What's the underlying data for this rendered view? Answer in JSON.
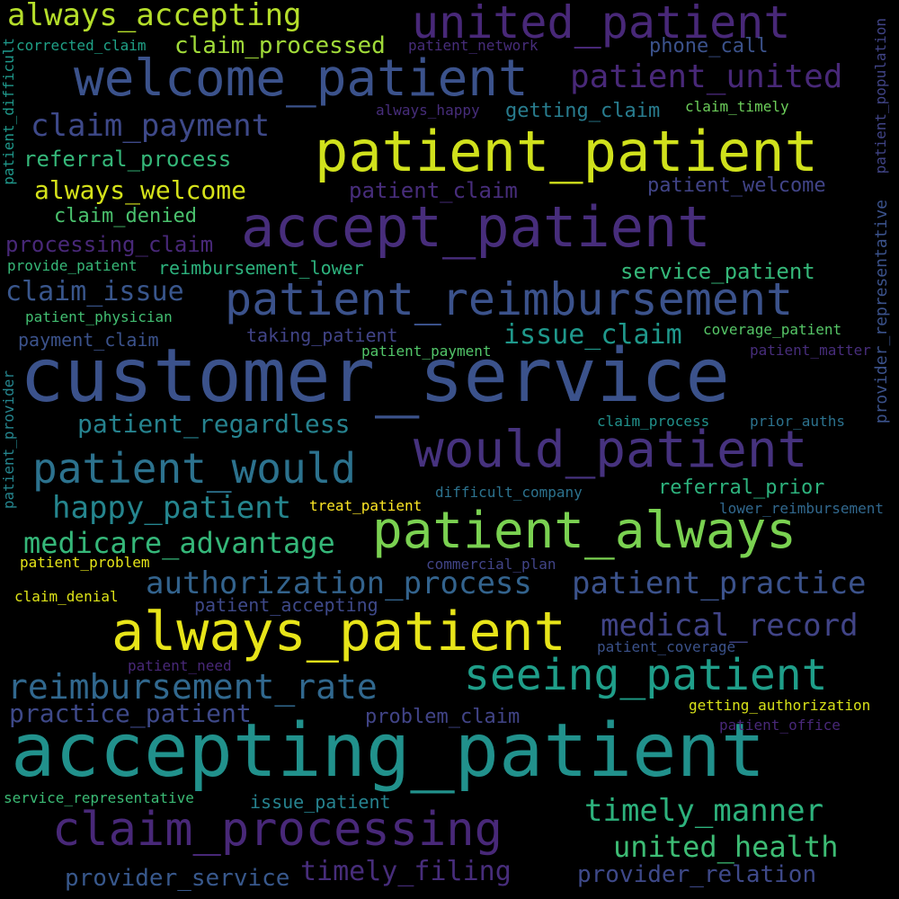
{
  "words": [
    {
      "key": "customer_service",
      "text": "customer_service",
      "color": "#3b528b"
    },
    {
      "key": "accepting_patient",
      "text": "accepting_patient",
      "color": "#21918c"
    },
    {
      "key": "patient_patient",
      "text": "patient_patient",
      "color": "#d0e11c"
    },
    {
      "key": "accept_patient",
      "text": "accept_patient",
      "color": "#472d7b"
    },
    {
      "key": "welcome_patient",
      "text": "welcome_patient",
      "color": "#3b528b"
    },
    {
      "key": "united_patient",
      "text": "united_patient",
      "color": "#482878"
    },
    {
      "key": "patient_always",
      "text": "patient_always",
      "color": "#7ad151"
    },
    {
      "key": "always_patient",
      "text": "always_patient",
      "color": "#e7e419"
    },
    {
      "key": "would_patient",
      "text": "would_patient",
      "color": "#46327e"
    },
    {
      "key": "patient_reimbursement",
      "text": "patient_reimbursement",
      "color": "#3b528b"
    },
    {
      "key": "claim_processing",
      "text": "claim_processing",
      "color": "#482878"
    },
    {
      "key": "patient_would",
      "text": "patient_would",
      "color": "#2c728e"
    },
    {
      "key": "seeing_patient",
      "text": "seeing_patient",
      "color": "#1f9e89"
    },
    {
      "key": "reimbursement_rate",
      "text": "reimbursement_rate",
      "color": "#31688e"
    },
    {
      "key": "patient_united",
      "text": "patient_united",
      "color": "#482878"
    },
    {
      "key": "claim_payment",
      "text": "claim_payment",
      "color": "#3e4989"
    },
    {
      "key": "always_accepting",
      "text": "always_accepting",
      "color": "#b5de2b"
    },
    {
      "key": "medical_record",
      "text": "medical_record",
      "color": "#414487"
    },
    {
      "key": "authorization_process",
      "text": "authorization_process",
      "color": "#33638d"
    },
    {
      "key": "patient_practice",
      "text": "patient_practice",
      "color": "#3b528b"
    },
    {
      "key": "medicare_advantage",
      "text": "medicare_advantage",
      "color": "#35b779"
    },
    {
      "key": "happy_patient",
      "text": "happy_patient",
      "color": "#25858e"
    },
    {
      "key": "timely_manner",
      "text": "timely_manner",
      "color": "#2db27d"
    },
    {
      "key": "united_health",
      "text": "united_health",
      "color": "#3dbc74"
    },
    {
      "key": "issue_claim",
      "text": "issue_claim",
      "color": "#1f988b"
    },
    {
      "key": "claim_issue",
      "text": "claim_issue",
      "color": "#39568c"
    },
    {
      "key": "patient_regardless",
      "text": "patient_regardless",
      "color": "#26828e"
    },
    {
      "key": "practice_patient",
      "text": "practice_patient",
      "color": "#3e4989"
    },
    {
      "key": "timely_filing",
      "text": "timely_filing",
      "color": "#472d7b"
    },
    {
      "key": "provider_relation",
      "text": "provider_relation",
      "color": "#3e4989"
    },
    {
      "key": "provider_service",
      "text": "provider_service",
      "color": "#38588c"
    },
    {
      "key": "claim_processed",
      "text": "claim_processed",
      "color": "#a0da39"
    },
    {
      "key": "always_welcome",
      "text": "always_welcome",
      "color": "#d5e21a"
    },
    {
      "key": "referral_process",
      "text": "referral_process",
      "color": "#35b779"
    },
    {
      "key": "processing_claim",
      "text": "processing_claim",
      "color": "#482878"
    },
    {
      "key": "service_patient",
      "text": "service_patient",
      "color": "#35b779"
    },
    {
      "key": "referral_prior",
      "text": "referral_prior",
      "color": "#2db27d"
    },
    {
      "key": "patient_claim",
      "text": "patient_claim",
      "color": "#472d7b"
    },
    {
      "key": "patient_welcome",
      "text": "patient_welcome",
      "color": "#414487"
    },
    {
      "key": "claim_denied",
      "text": "claim_denied",
      "color": "#4ac16d"
    },
    {
      "key": "getting_claim",
      "text": "getting_claim",
      "color": "#287c8e"
    },
    {
      "key": "phone_call",
      "text": "phone_call",
      "color": "#3b528b"
    },
    {
      "key": "reimbursement_lower",
      "text": "reimbursement_lower",
      "color": "#2db27d"
    },
    {
      "key": "taking_patient",
      "text": "taking_patient",
      "color": "#414487"
    },
    {
      "key": "payment_claim",
      "text": "payment_claim",
      "color": "#3b528b"
    },
    {
      "key": "problem_claim",
      "text": "problem_claim",
      "color": "#414487"
    },
    {
      "key": "issue_patient",
      "text": "issue_patient",
      "color": "#26828e"
    },
    {
      "key": "patient_accepting",
      "text": "patient_accepting",
      "color": "#3e4989"
    },
    {
      "key": "corrected_claim",
      "text": "corrected_claim",
      "color": "#1fa187"
    },
    {
      "key": "patient_network",
      "text": "patient_network",
      "color": "#472d7b"
    },
    {
      "key": "always_happy",
      "text": "always_happy",
      "color": "#472d7b"
    },
    {
      "key": "claim_timely",
      "text": "claim_timely",
      "color": "#6ccd5a"
    },
    {
      "key": "provide_patient",
      "text": "provide_patient",
      "color": "#37b878"
    },
    {
      "key": "patient_physician",
      "text": "patient_physician",
      "color": "#42be71"
    },
    {
      "key": "patient_payment",
      "text": "patient_payment",
      "color": "#52c569"
    },
    {
      "key": "coverage_patient",
      "text": "coverage_patient",
      "color": "#56c667"
    },
    {
      "key": "patient_matter",
      "text": "patient_matter",
      "color": "#472d7b"
    },
    {
      "key": "claim_process",
      "text": "claim_process",
      "color": "#21918c"
    },
    {
      "key": "prior_auths",
      "text": "prior_auths",
      "color": "#2c728e"
    },
    {
      "key": "difficult_company",
      "text": "difficult_company",
      "color": "#2c728e"
    },
    {
      "key": "treat_patient",
      "text": "treat_patient",
      "color": "#fde725"
    },
    {
      "key": "lower_reimbursement",
      "text": "lower_reimbursement",
      "color": "#31688e"
    },
    {
      "key": "patient_problem",
      "text": "patient_problem",
      "color": "#e5e419"
    },
    {
      "key": "commercial_plan",
      "text": "commercial_plan",
      "color": "#414487"
    },
    {
      "key": "claim_denial",
      "text": "claim_denial",
      "color": "#dde318"
    },
    {
      "key": "patient_coverage",
      "text": "patient_coverage",
      "color": "#3b528b"
    },
    {
      "key": "patient_need",
      "text": "patient_need",
      "color": "#482878"
    },
    {
      "key": "getting_authorization",
      "text": "getting_authorization",
      "color": "#d8e219"
    },
    {
      "key": "patient_office",
      "text": "patient_office",
      "color": "#482878"
    },
    {
      "key": "service_representative",
      "text": "service_representative",
      "color": "#3bbb75"
    },
    {
      "key": "patient_difficult",
      "text": "patient_difficult",
      "color": "#1f988b"
    },
    {
      "key": "patient_provider",
      "text": "patient_provider",
      "color": "#25858e"
    },
    {
      "key": "patient_population",
      "text": "patient_population",
      "color": "#414487"
    },
    {
      "key": "provider_representative",
      "text": "provider_representative",
      "color": "#3b528b"
    }
  ]
}
